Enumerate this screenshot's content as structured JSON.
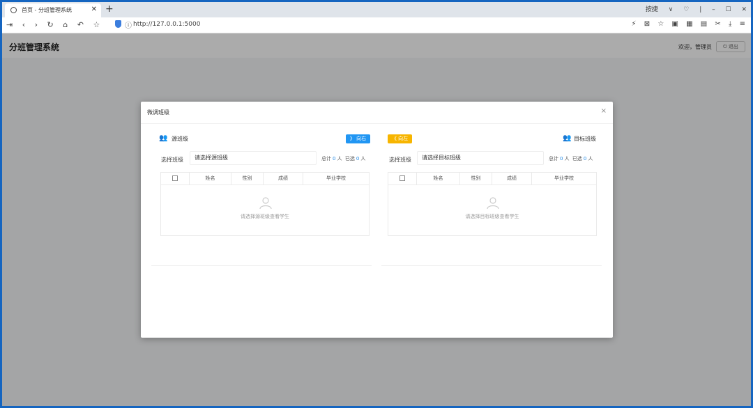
{
  "browser": {
    "tab_title": "首页 - 分班管理系统",
    "tab_close": "✕",
    "new_tab": "+",
    "url": "http://127.0.0.1:5000",
    "win_controls": [
      "按捷",
      "∨",
      "♡",
      "|",
      "–",
      "☐",
      "✕"
    ],
    "nav_icons": [
      "⇥",
      "‹",
      "›",
      "↻",
      "⌂",
      "↶",
      "☆"
    ],
    "right_icons": [
      "⚡",
      "⊠",
      "☆",
      "▣",
      "▦",
      "▤",
      "✂",
      "⤓",
      "≡"
    ]
  },
  "app": {
    "title": "分班管理系统",
    "welcome": "欢迎，管理员",
    "logout": "退出"
  },
  "modal": {
    "title": "微调班级",
    "close": "×",
    "source": {
      "label": "源班级",
      "move_button": "》 向右",
      "select_label": "选择班级",
      "select_placeholder": "请选择源班级",
      "total_label": "总计",
      "total_value": "0",
      "selected_label": "已选",
      "selected_value": "0",
      "unit": "人",
      "empty_text": "请选择源班级查看学生"
    },
    "target": {
      "label": "目标班级",
      "move_button": "《 向左",
      "select_label": "选择班级",
      "select_placeholder": "请选择目标班级",
      "total_label": "总计",
      "total_value": "0",
      "selected_label": "已选",
      "selected_value": "0",
      "unit": "人",
      "empty_text": "请选择目标班级查看学生"
    },
    "columns": [
      "姓名",
      "性别",
      "成绩",
      "毕业学校"
    ]
  },
  "colors": {
    "move_right": "#2196f3",
    "move_left": "#f7b500",
    "source_icon": "#1e88e5",
    "target_icon": "#43a047"
  }
}
